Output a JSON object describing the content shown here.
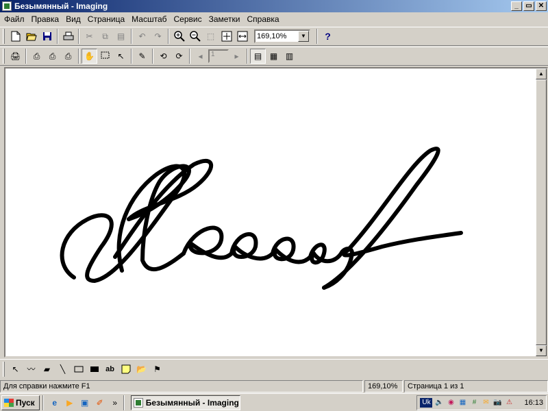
{
  "window": {
    "title": "Безымянный - Imaging",
    "controls": [
      "_",
      "▭",
      "✕"
    ]
  },
  "menu": [
    "Файл",
    "Правка",
    "Вид",
    "Страница",
    "Масштаб",
    "Сервис",
    "Заметки",
    "Справка"
  ],
  "toolbar": {
    "zoom_value": "169,10%",
    "help_label": "?",
    "page_number": "1"
  },
  "statusbar": {
    "help_text": "Для справки нажмите F1",
    "zoom": "169,10%",
    "page": "Страница 1 из 1"
  },
  "taskbar": {
    "start_label": "Пуск",
    "task_label": "Безымянный - Imaging",
    "lang": "Uk",
    "clock": "16:13",
    "chevron": "»"
  },
  "icons": {
    "new": "new-doc-icon",
    "open": "open-icon",
    "save": "save-icon",
    "print": "print-icon",
    "cut": "cut-icon",
    "copy": "copy-icon",
    "paste": "paste-icon",
    "undo": "undo-icon",
    "redo": "redo-icon",
    "zoom_in": "zoom-in-icon",
    "zoom_out": "zoom-out-icon"
  },
  "colors": {
    "title_active": "#0a246a",
    "face": "#d4d0c8",
    "ink": "#000000"
  }
}
